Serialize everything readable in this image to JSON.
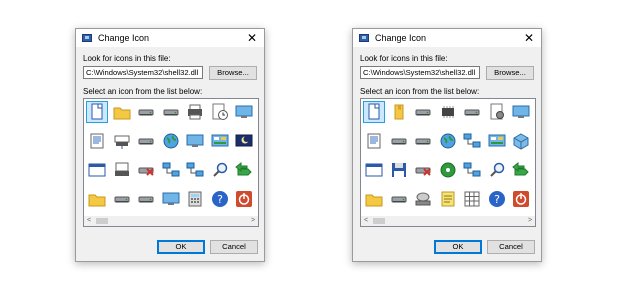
{
  "dialogs": [
    {
      "title": "Change Icon",
      "close_glyph": "✕",
      "lookfor_label": "Look for icons in this file:",
      "path_value": "C:\\Windows\\System32\\shell32.dll",
      "browse_label": "Browse...",
      "select_label": "Select an icon from the list below:",
      "ok_label": "OK",
      "cancel_label": "Cancel",
      "scroll_left": "<",
      "scroll_right": ">",
      "icons": [
        [
          "document-icon",
          "folder-icon",
          "drive-icon",
          "drive-icon",
          "printer-icon",
          "clock-icon",
          "monitor-icon"
        ],
        [
          "text-document-icon",
          "network-drive-icon",
          "drive-icon",
          "globe-icon",
          "monitor-icon",
          "control-panel-icon",
          "moon-icon"
        ],
        [
          "window-icon",
          "computer-icon",
          "removed-drive-icon",
          "network-icon",
          "network-icon",
          "search-icon",
          "arrow-folder-icon"
        ],
        [
          "folder-icon",
          "drive-icon",
          "drive-icon",
          "monitor-icon",
          "calculator-icon",
          "help-icon",
          "power-icon"
        ]
      ]
    },
    {
      "title": "Change Icon",
      "close_glyph": "✕",
      "lookfor_label": "Look for icons in this file:",
      "path_value": "C:\\Windows\\System32\\shell32.dll",
      "browse_label": "Browse...",
      "select_label": "Select an icon from the list below:",
      "ok_label": "OK",
      "cancel_label": "Cancel",
      "scroll_left": "<",
      "scroll_right": ">",
      "icons": [
        [
          "document-icon",
          "bookmark-folder-icon",
          "drive-icon",
          "chip-icon",
          "drive-icon",
          "settings-document-icon",
          "monitor-icon"
        ],
        [
          "text-document-icon",
          "drive-icon",
          "drive-icon",
          "globe-icon",
          "network-icon",
          "control-panel-icon",
          "cube-icon"
        ],
        [
          "window-icon",
          "floppy-icon",
          "removed-drive-icon",
          "cd-icon",
          "network-icon",
          "search-icon",
          "arrow-folder-icon"
        ],
        [
          "folder-icon",
          "drive-icon",
          "optical-drive-icon",
          "note-icon",
          "grid-icon",
          "help-icon",
          "power-icon"
        ]
      ]
    }
  ],
  "colors": {
    "selection": "#cce8ff",
    "selection_border": "#26a0da",
    "accent": "#0078d7",
    "folder": "#f4c842",
    "help": "#2b64c8",
    "power": "#d04a2e"
  }
}
